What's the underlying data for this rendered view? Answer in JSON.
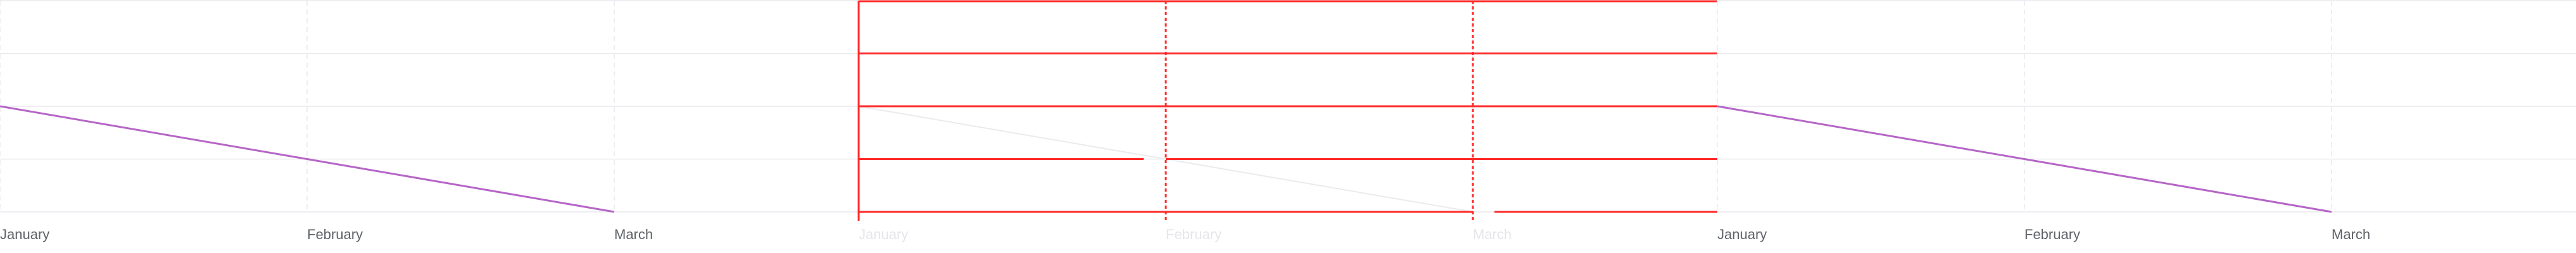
{
  "colors": {
    "background": "#ffffff",
    "grid": "#e9e9ee",
    "series": "#b565c7",
    "series_faded": "#ebebef",
    "highlight": "#ff2a2a",
    "tick_text": "#5f6368",
    "tick_text_faded": "#e6e6ea"
  },
  "chart_data": [
    {
      "type": "line",
      "categories": [
        "January",
        "February",
        "March"
      ],
      "series": [
        {
          "values": [
            2,
            1,
            0
          ]
        }
      ],
      "ylim": [
        0,
        4
      ],
      "grid": true,
      "faded": false,
      "highlight": false
    },
    {
      "type": "line",
      "categories": [
        "January",
        "February",
        "March"
      ],
      "series": [
        {
          "values": [
            2,
            1,
            0
          ]
        }
      ],
      "ylim": [
        0,
        4
      ],
      "grid": true,
      "faded": true,
      "highlight": true
    },
    {
      "type": "line",
      "categories": [
        "January",
        "February",
        "March"
      ],
      "series": [
        {
          "values": [
            2,
            1,
            0
          ]
        }
      ],
      "ylim": [
        0,
        4
      ],
      "grid": true,
      "faded": false,
      "highlight": false
    }
  ]
}
